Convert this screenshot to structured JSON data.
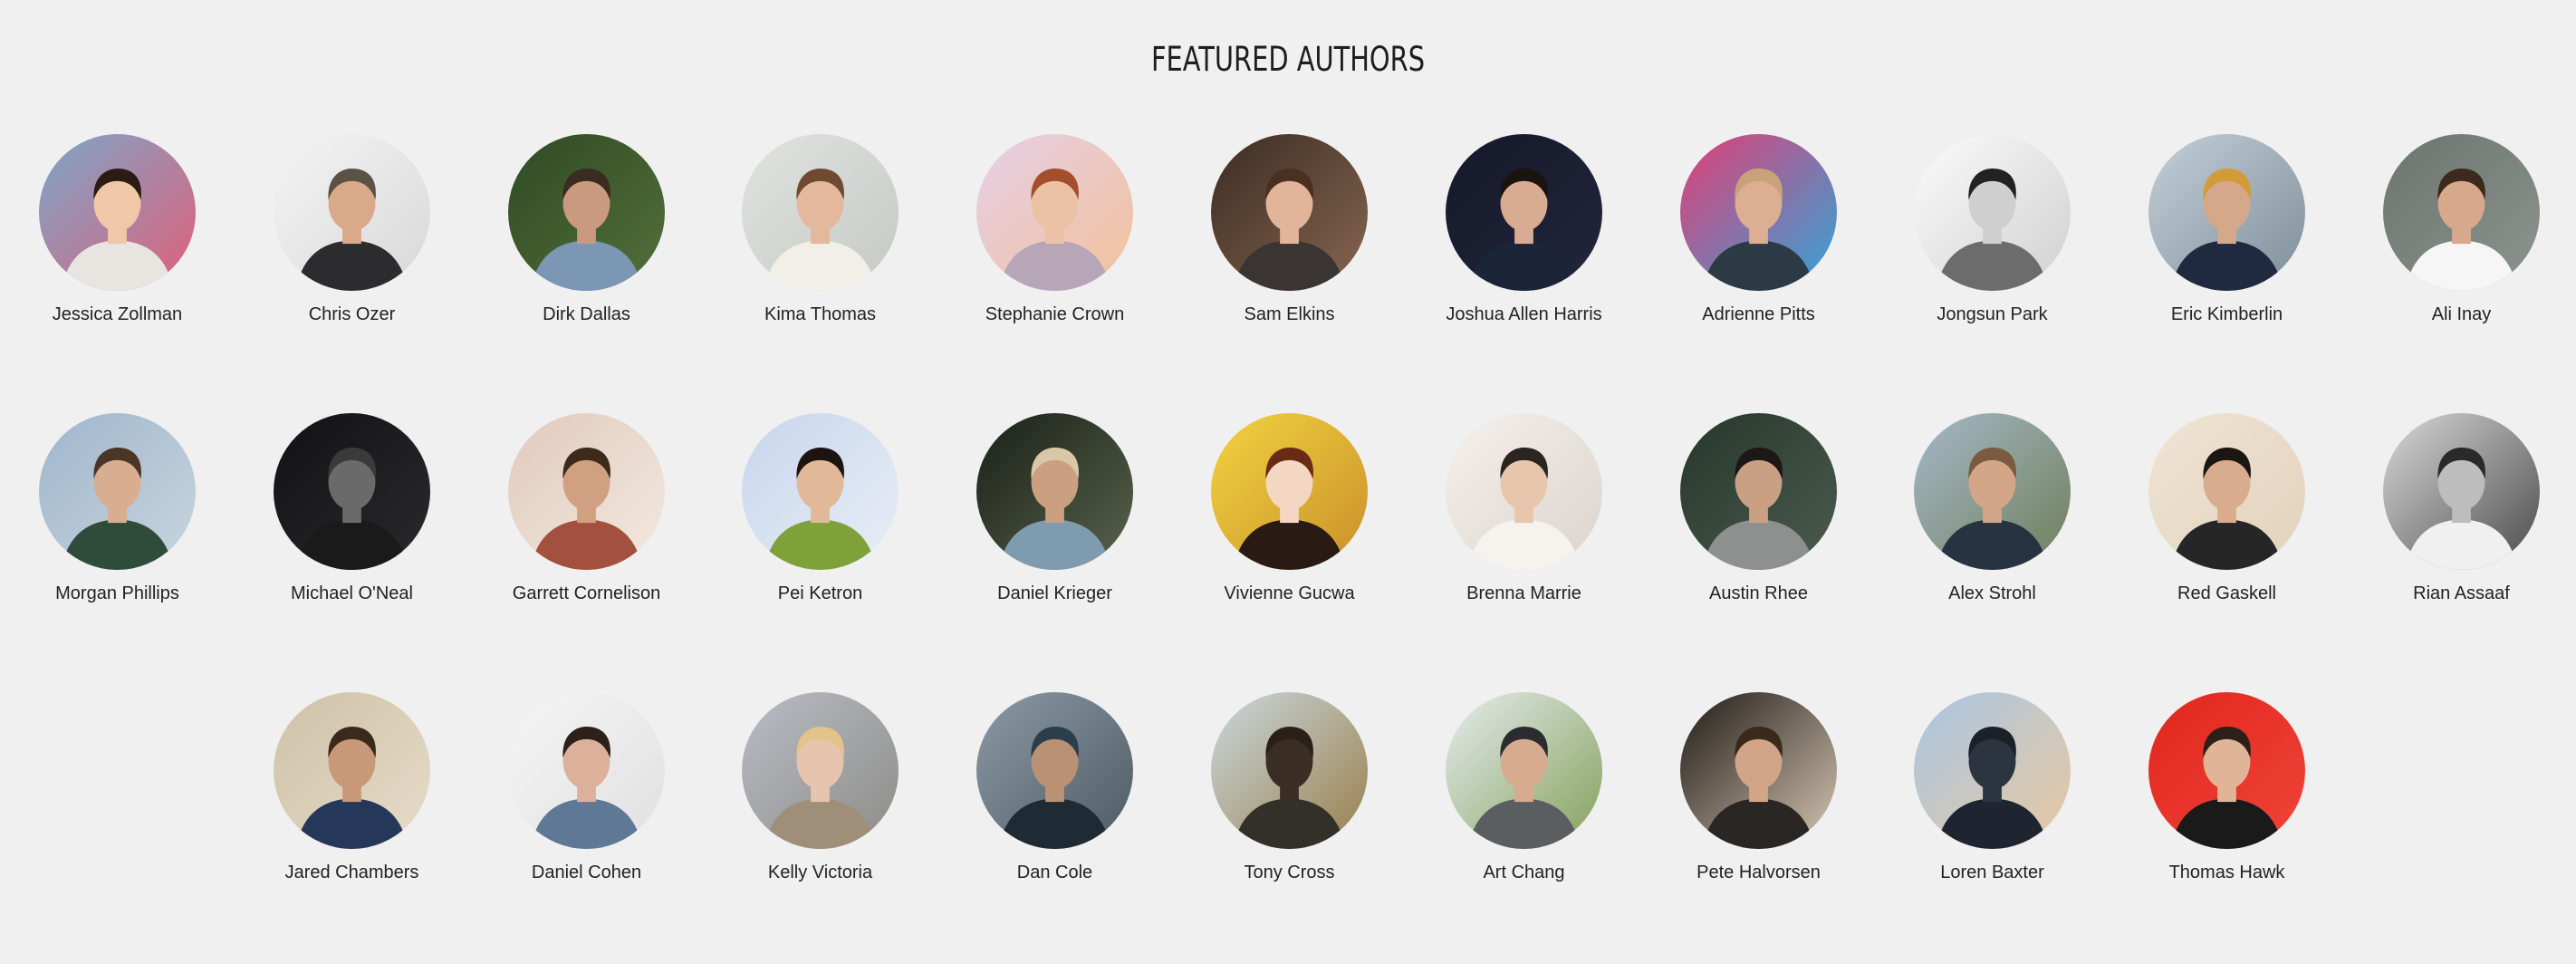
{
  "heading": "FEATURED AUTHORS",
  "rows": [
    [
      {
        "name": "Jessica Zollman",
        "bg": "#7ca6c9",
        "accent": "#e0607a",
        "skin": "#f0c8a8",
        "hair": "#2a1c14",
        "shirt": "#e8e4e0",
        "dark": false
      },
      {
        "name": "Chris Ozer",
        "bg": "#f4f4f4",
        "accent": "#d8d8d8",
        "skin": "#d9a98a",
        "hair": "#5b5246",
        "shirt": "#2c2c2e",
        "dark": false
      },
      {
        "name": "Dirk Dallas",
        "bg": "#2f4a24",
        "accent": "#52703a",
        "skin": "#c99a80",
        "hair": "#3a2c20",
        "shirt": "#7c97b4",
        "dark": true
      },
      {
        "name": "Kima Thomas",
        "bg": "#dfe3df",
        "accent": "#c6c9c4",
        "skin": "#e4b89c",
        "hair": "#6f4a30",
        "shirt": "#f1efe8",
        "dark": false
      },
      {
        "name": "Stephanie Crown",
        "bg": "#e6cfe8",
        "accent": "#f2c19a",
        "skin": "#ecc2a6",
        "hair": "#a34f2c",
        "shirt": "#b6a6b8",
        "dark": false
      },
      {
        "name": "Sam Elkins",
        "bg": "#3b2c22",
        "accent": "#876651",
        "skin": "#e2b49a",
        "hair": "#4a3020",
        "shirt": "#3a3532",
        "dark": true
      },
      {
        "name": "Joshua Allen Harris",
        "bg": "#16182a",
        "accent": "#22263a",
        "skin": "#d8ab92",
        "hair": "#1a1410",
        "shirt": "#1c2438",
        "dark": true
      },
      {
        "name": "Adrienne Pitts",
        "bg": "#e23d76",
        "accent": "#30a6d8",
        "skin": "#dcae92",
        "hair": "#caa27a",
        "shirt": "#2b3a44",
        "dark": false
      },
      {
        "name": "Jongsun Park",
        "bg": "#fbfbfb",
        "accent": "#d0d0d0",
        "skin": "#cfcfcf",
        "hair": "#222",
        "shirt": "#6c6c6c",
        "dark": false
      },
      {
        "name": "Eric Kimberlin",
        "bg": "#c3cfd9",
        "accent": "#7f8e99",
        "skin": "#d6a88a",
        "hair": "#d39a38",
        "shirt": "#1f2a40",
        "dark": false
      },
      {
        "name": "Ali Inay",
        "bg": "#6c746f",
        "accent": "#8d948f",
        "skin": "#d7a88c",
        "hair": "#3c2a1e",
        "shirt": "#f6f6f6",
        "dark": true
      }
    ],
    [
      {
        "name": "Morgan Phillips",
        "bg": "#9fb6cc",
        "accent": "#c9d5df",
        "skin": "#d9ad90",
        "hair": "#4a3626",
        "shirt": "#2f4c3a",
        "dark": false
      },
      {
        "name": "Michael O'Neal",
        "bg": "#121214",
        "accent": "#2a2a2c",
        "skin": "#6a6a6a",
        "hair": "#3a3a3a",
        "shirt": "#1a1a1a",
        "dark": true
      },
      {
        "name": "Garrett Cornelison",
        "bg": "#e0cabc",
        "accent": "#f3e9e0",
        "skin": "#d0a080",
        "hair": "#3c2a1c",
        "shirt": "#a3503e",
        "dark": false
      },
      {
        "name": "Pei Ketron",
        "bg": "#c7d6ec",
        "accent": "#e9eef6",
        "skin": "#e1b898",
        "hair": "#1c1410",
        "shirt": "#7ea13a",
        "dark": false
      },
      {
        "name": "Daniel Krieger",
        "bg": "#1a2018",
        "accent": "#59634c",
        "skin": "#caa080",
        "hair": "#d8c8a8",
        "shirt": "#7f9bb0",
        "dark": true
      },
      {
        "name": "Vivienne Gucwa",
        "bg": "#f2d340",
        "accent": "#c9902a",
        "skin": "#f3d7c2",
        "hair": "#6a2a14",
        "shirt": "#2a1a14",
        "dark": false
      },
      {
        "name": "Brenna Marrie",
        "bg": "#f4f0ec",
        "accent": "#dcd4cc",
        "skin": "#e8c6ad",
        "hair": "#2c2420",
        "shirt": "#f6f2ee",
        "dark": false
      },
      {
        "name": "Austin Rhee",
        "bg": "#26362c",
        "accent": "#4b5c4f",
        "skin": "#caa084",
        "hair": "#1c1816",
        "shirt": "#8e9090",
        "dark": true
      },
      {
        "name": "Alex Strohl",
        "bg": "#a6b8c8",
        "accent": "#6e7f5a",
        "skin": "#d4a688",
        "hair": "#7a5a40",
        "shirt": "#273340",
        "dark": false
      },
      {
        "name": "Red Gaskell",
        "bg": "#efe4d4",
        "accent": "#e2d2bc",
        "skin": "#d8ac8c",
        "hair": "#1c1612",
        "shirt": "#262626",
        "dark": false
      },
      {
        "name": "Rian Assaaf",
        "bg": "#d9d9d9",
        "accent": "#4a4a4a",
        "skin": "#bdbdbd",
        "hair": "#2a2a2a",
        "shirt": "#f0f0f0",
        "dark": false
      }
    ],
    [
      {
        "name": "Jared Chambers",
        "bg": "#cfc1a8",
        "accent": "#e6dcc9",
        "skin": "#c99878",
        "hair": "#3a2a1c",
        "shirt": "#26385a",
        "dark": false
      },
      {
        "name": "Daniel Cohen",
        "bg": "#f5f5f5",
        "accent": "#e0e0e0",
        "skin": "#dcb09a",
        "hair": "#2c2018",
        "shirt": "#5f7896",
        "dark": false
      },
      {
        "name": "Kelly Victoria",
        "bg": "#b8bcc4",
        "accent": "#8d8c88",
        "skin": "#e6c4ad",
        "hair": "#e2c48a",
        "shirt": "#a08f78",
        "dark": false
      },
      {
        "name": "Dan Cole",
        "bg": "#8c9aa5",
        "accent": "#4d5a64",
        "skin": "#b99276",
        "hair": "#2c3e4c",
        "shirt": "#1e2a34",
        "dark": false
      },
      {
        "name": "Tony Cross",
        "bg": "#c9d8df",
        "accent": "#9a7e4a",
        "skin": "#3a2e24",
        "hair": "#2a2018",
        "shirt": "#33302a",
        "dark": false
      },
      {
        "name": "Art Chang",
        "bg": "#e6ecef",
        "accent": "#83a05a",
        "skin": "#d7ac8e",
        "hair": "#2c2c30",
        "shirt": "#5b5e60",
        "dark": false
      },
      {
        "name": "Pete Halvorsen",
        "bg": "#1e1a16",
        "accent": "#d8c8b4",
        "skin": "#d2a488",
        "hair": "#3a2a1c",
        "shirt": "#2a2624",
        "dark": true
      },
      {
        "name": "Loren Baxter",
        "bg": "#a9c6e4",
        "accent": "#e9c9a0",
        "skin": "#2c3440",
        "hair": "#1c2028",
        "shirt": "#1f2530",
        "dark": false
      },
      {
        "name": "Thomas Hawk",
        "bg": "#e1261c",
        "accent": "#f0443a",
        "skin": "#e0b496",
        "hair": "#2c2018",
        "shirt": "#1a1a1a",
        "dark": false
      }
    ]
  ]
}
